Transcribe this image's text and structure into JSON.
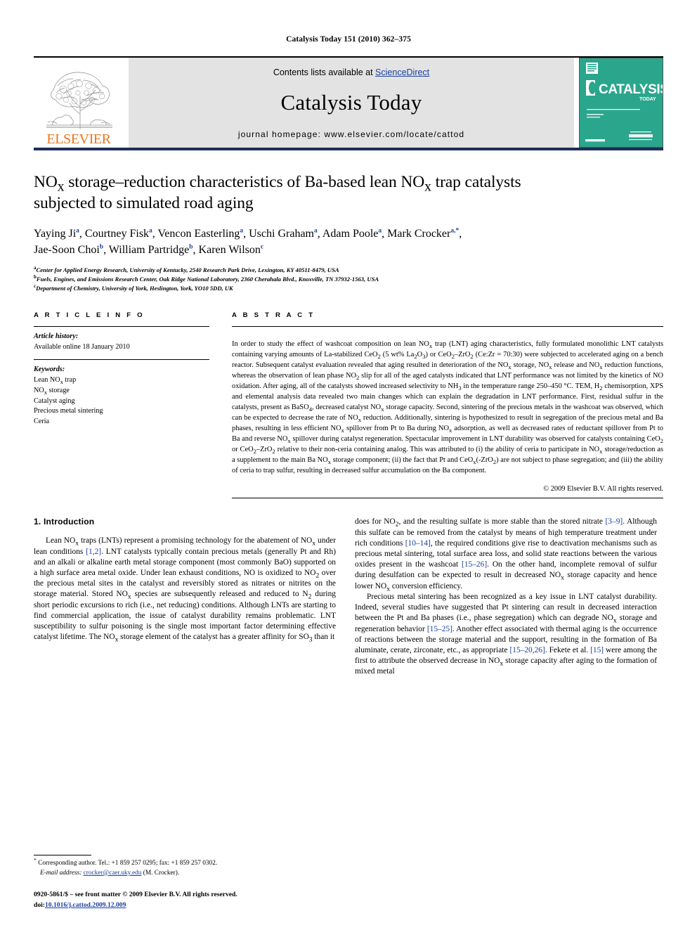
{
  "running_head": "Catalysis Today 151 (2010) 362–375",
  "masthead": {
    "publisher_name": "ELSEVIER",
    "contents_prefix": "Contents lists available at ",
    "contents_link": "ScienceDirect",
    "journal_title": "Catalysis Today",
    "homepage": "journal homepage: www.elsevier.com/locate/cattod",
    "cover_title": "CATALYSIS",
    "cover_subtitle": "TODAY",
    "cover_color": "#2aa68d",
    "link_color": "#1a3fa0",
    "elsevier_orange": "#E87722",
    "rule_color": "#1d2d5c"
  },
  "article": {
    "title_line1": "NO",
    "title_sub1": "x",
    "title_line1b": " storage–reduction characteristics of Ba-based lean NO",
    "title_sub2": "x",
    "title_line1c": " trap catalysts",
    "title_line2": "subjected to simulated road aging",
    "title_plain": "NOx storage–reduction characteristics of Ba-based lean NOx trap catalysts subjected to simulated road aging",
    "authors_line1": "Yaying Ji a, Courtney Fisk a, Vencon Easterling a, Uschi Graham a, Adam Poole a, Mark Crocker a,*,",
    "authors_line2": "Jae-Soon Choi b, William Partridge b, Karen Wilson c",
    "authors": [
      {
        "name": "Yaying Ji",
        "marks": "a"
      },
      {
        "name": "Courtney Fisk",
        "marks": "a"
      },
      {
        "name": "Vencon Easterling",
        "marks": "a"
      },
      {
        "name": "Uschi Graham",
        "marks": "a"
      },
      {
        "name": "Adam Poole",
        "marks": "a"
      },
      {
        "name": "Mark Crocker",
        "marks": "a,*"
      },
      {
        "name": "Jae-Soon Choi",
        "marks": "b"
      },
      {
        "name": "William Partridge",
        "marks": "b"
      },
      {
        "name": "Karen Wilson",
        "marks": "c"
      }
    ],
    "affiliations": [
      {
        "mark": "a",
        "text": "Center for Applied Energy Research, University of Kentucky, 2540 Research Park Drive, Lexington, KY 40511-8479, USA"
      },
      {
        "mark": "b",
        "text": "Fuels, Engines, and Emissions Research Center, Oak Ridge National Laboratory, 2360 Cherahala Blvd., Knoxville, TN 37932-1563, USA"
      },
      {
        "mark": "c",
        "text": "Department of Chemistry, University of York, Heslington, York, YO10 5DD, UK"
      }
    ]
  },
  "article_info": {
    "heading": "A R T I C L E    I N F O",
    "history_label": "Article history:",
    "history_value": "Available online 18 January 2010",
    "keywords_label": "Keywords:",
    "keywords": [
      "Lean NOx trap",
      "NOx storage",
      "Catalyst aging",
      "Precious metal sintering",
      "Ceria"
    ]
  },
  "abstract": {
    "heading": "A B S T R A C T",
    "body": "In order to study the effect of washcoat composition on lean NOx trap (LNT) aging characteristics, fully formulated monolithic LNT catalysts containing varying amounts of La-stabilized CeO2 (5 wt% La2O3) or CeO2–ZrO2 (Ce:Zr = 70:30) were subjected to accelerated aging on a bench reactor. Subsequent catalyst evaluation revealed that aging resulted in deterioration of the NOx storage, NOx release and NOx reduction functions, whereas the observation of lean phase NO2 slip for all of the aged catalysts indicated that LNT performance was not limited by the kinetics of NO oxidation. After aging, all of the catalysts showed increased selectivity to NH3 in the temperature range 250–450 °C. TEM, H2 chemisorption, XPS and elemental analysis data revealed two main changes which can explain the degradation in LNT performance. First, residual sulfur in the catalysts, present as BaSO4, decreased catalyst NOx storage capacity. Second, sintering of the precious metals in the washcoat was observed, which can be expected to decrease the rate of NOx reduction. Additionally, sintering is hypothesized to result in segregation of the precious metal and Ba phases, resulting in less efficient NOx spillover from Pt to Ba during NOx adsorption, as well as decreased rates of reductant spillover from Pt to Ba and reverse NOx spillover during catalyst regeneration. Spectacular improvement in LNT durability was observed for catalysts containing CeO2 or CeO2–ZrO2 relative to their non-ceria containing analog. This was attributed to (i) the ability of ceria to participate in NOx storage/reduction as a supplement to the main Ba NOx storage component; (ii) the fact that Pt and CeOx(-ZrO2) are not subject to phase segregation; and (iii) the ability of ceria to trap sulfur, resulting in decreased sulfur accumulation on the Ba component.",
    "copyright": "© 2009 Elsevier B.V. All rights reserved."
  },
  "introduction": {
    "heading": "1. Introduction",
    "left_para1": "Lean NOx traps (LNTs) represent a promising technology for the abatement of NOx under lean conditions [1,2]. LNT catalysts typically contain precious metals (generally Pt and Rh) and an alkali or alkaline earth metal storage component (most commonly BaO) supported on a high surface area metal oxide. Under lean exhaust conditions, NO is oxidized to NO2 over the precious metal sites in the catalyst and reversibly stored as nitrates or nitrites on the storage material. Stored NOx species are subsequently released and reduced to N2 during short periodic excursions to rich (i.e., net reducing) conditions. Although LNTs are starting to find commercial application, the issue of catalyst durability remains problematic. LNT susceptibility to sulfur poisoning is the single most important factor determining effective catalyst lifetime. The NOx storage element of the catalyst has a greater affinity for SO3 than it",
    "right_para1": "does for NO2, and the resulting sulfate is more stable than the stored nitrate [3–9]. Although this sulfate can be removed from the catalyst by means of high temperature treatment under rich conditions [10–14], the required conditions give rise to deactivation mechanisms such as precious metal sintering, total surface area loss, and solid state reactions between the various oxides present in the washcoat [15–26]. On the other hand, incomplete removal of sulfur during desulfation can be expected to result in decreased NOx storage capacity and hence lower NOx conversion efficiency.",
    "right_para2": "Precious metal sintering has been recognized as a key issue in LNT catalyst durability. Indeed, several studies have suggested that Pt sintering can result in decreased interaction between the Pt and Ba phases (i.e., phase segregation) which can degrade NOx storage and regeneration behavior [15–25]. Another effect associated with thermal aging is the occurrence of reactions between the storage material and the support, resulting in the formation of Ba aluminate, cerate, zirconate, etc., as appropriate [15–20,26]. Fekete et al. [15] were among the first to attribute the observed decrease in NOx storage capacity after aging to the formation of mixed metal"
  },
  "footnote": {
    "marker": "*",
    "corresponding": "Corresponding author. Tel.: +1 859 257 0295; fax: +1 859 257 0302.",
    "email_label": "E-mail address:",
    "email": "crocker@caer.uky.edu",
    "email_owner": "(M. Crocker)."
  },
  "imprint": {
    "line1": "0920-5861/$ – see front matter © 2009 Elsevier B.V. All rights reserved.",
    "doi_label": "doi:",
    "doi_value": "10.1016/j.cattod.2009.12.009"
  }
}
